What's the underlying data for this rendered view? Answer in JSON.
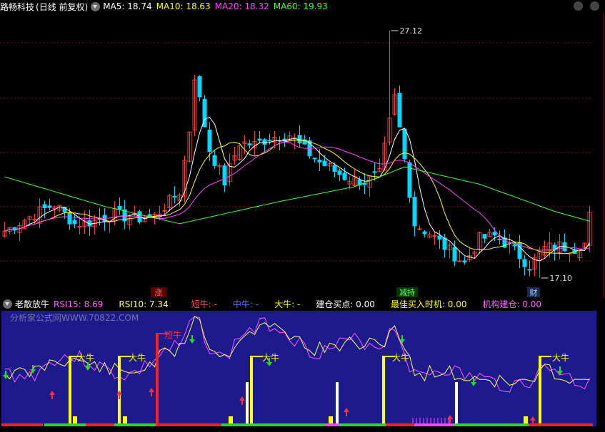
{
  "main_chart": {
    "stock_name": "路畅科技",
    "period": "(日线 前复权)",
    "ma_labels": [
      {
        "text": "MA5: 18.74",
        "color": "#ffffff"
      },
      {
        "text": "MA10: 18.63",
        "color": "#ffff00"
      },
      {
        "text": "MA20: 18.32",
        "color": "#ff44ff"
      },
      {
        "text": "MA60: 19.93",
        "color": "#44ff44"
      }
    ],
    "high_label": "27.12",
    "low_label": "17.10",
    "markers": [
      {
        "text": "涨",
        "bg": "#5a0000",
        "color": "#ff6666"
      },
      {
        "text": "减持",
        "bg": "#003a00",
        "color": "#66ff66"
      },
      {
        "text": "财",
        "bg": "#1a2a55",
        "color": "#aaccff"
      }
    ]
  },
  "indicator": {
    "name": "老散放牛",
    "labels": [
      {
        "text": "RSI15: 8.69",
        "color": "#ff66ff"
      },
      {
        "text": "RSI10: 7.34",
        "color": "#ffff66"
      },
      {
        "text": "短牛: -",
        "color": "#ff5555"
      },
      {
        "text": "中牛: -",
        "color": "#4488ff"
      },
      {
        "text": "大牛: -",
        "color": "#ffff00"
      },
      {
        "text": "建仓买点: 0.00",
        "color": "#ffffff"
      },
      {
        "text": "最佳买入时机: 0.00",
        "color": "#ffff00"
      },
      {
        "text": "机构建仓: 0.00",
        "color": "#ff66ff"
      }
    ],
    "watermark": "分析家公式网WWW.70822.COM",
    "bull_big": "大牛",
    "bull_short": "短牛"
  },
  "colors": {
    "up": "#ff3c3c",
    "down": "#00d8ff",
    "ma5": "#ffffff",
    "ma10": "#ffff00",
    "ma20": "#ff44ff",
    "ma60": "#44ff44",
    "panel_bg": "#1c1a8c"
  }
}
